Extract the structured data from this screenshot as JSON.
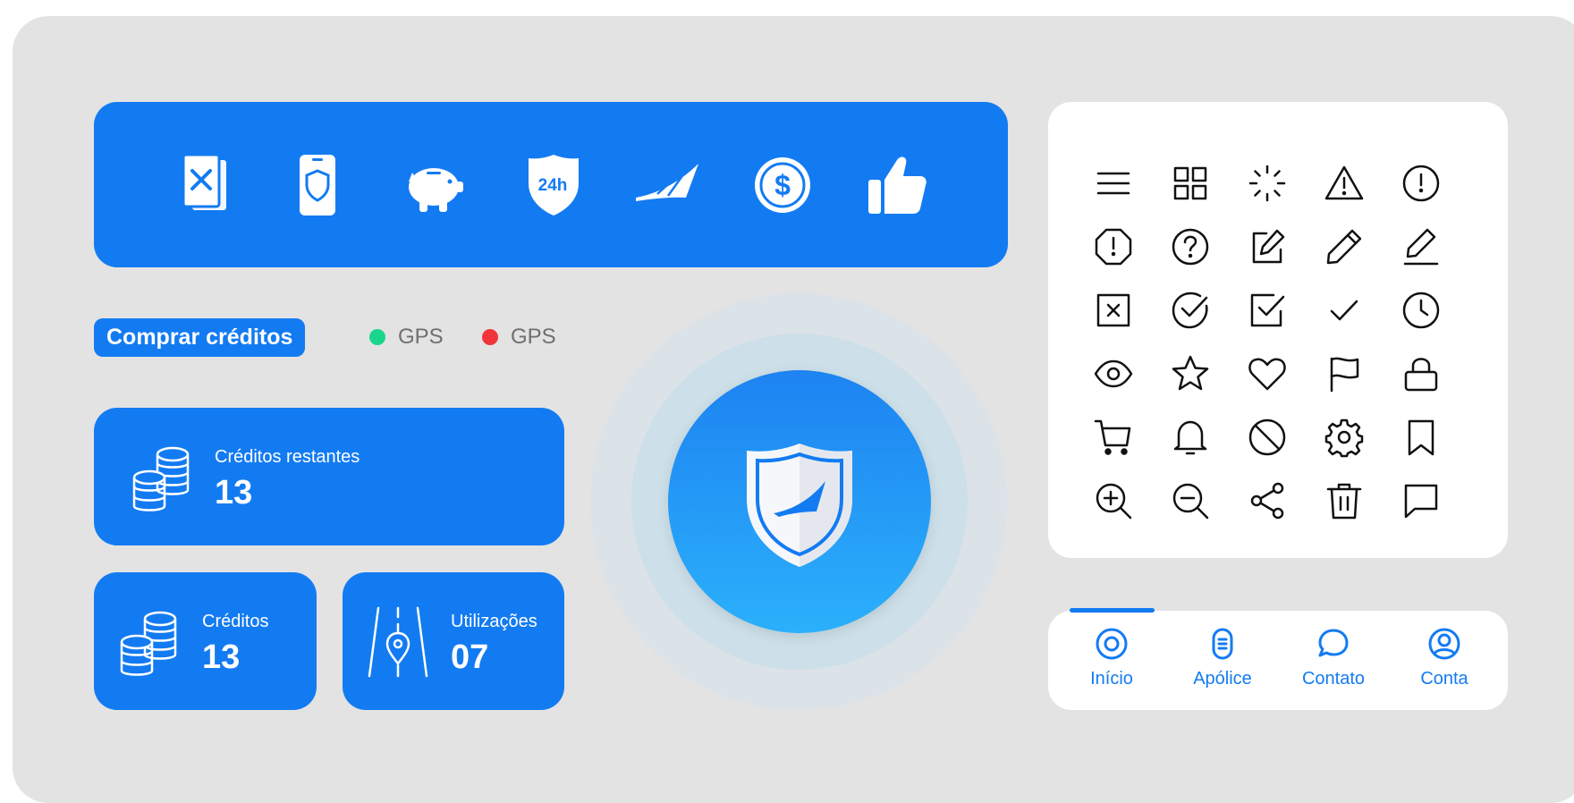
{
  "hero": {
    "icons": [
      "cancel-policy-icon",
      "phone-shield-icon",
      "piggy-bank-icon",
      "shield-24h-icon",
      "brand-wing-icon",
      "dollar-coin-icon",
      "thumbs-up-icon"
    ],
    "badge_text": "24h"
  },
  "buy_button": {
    "label": "Comprar créditos"
  },
  "gps": [
    {
      "label": "GPS",
      "color": "#19d68c"
    },
    {
      "label": "GPS",
      "color": "#f0353b"
    }
  ],
  "cards": {
    "remaining": {
      "label": "Créditos restantes",
      "value": "13",
      "icon": "coins-icon"
    },
    "credits": {
      "label": "Créditos",
      "value": "13",
      "icon": "coins-icon"
    },
    "uses": {
      "label": "Utilizações",
      "value": "07",
      "icon": "road-pin-icon"
    }
  },
  "center": {
    "icon": "shield-logo-icon"
  },
  "icon_grid": [
    "menu-icon",
    "grid-icon",
    "loading-icon",
    "warning-icon",
    "alert-circle-icon",
    "alert-octagon-icon",
    "help-icon",
    "edit-box-icon",
    "pencil-icon",
    "edit-line-icon",
    "close-square-icon",
    "check-circle-icon",
    "check-square-icon",
    "check-icon",
    "clock-icon",
    "eye-icon",
    "star-icon",
    "heart-icon",
    "flag-icon",
    "lock-icon",
    "cart-icon",
    "bell-icon",
    "block-icon",
    "settings-icon",
    "bookmark-icon",
    "zoom-in-icon",
    "zoom-out-icon",
    "share-icon",
    "trash-icon",
    "chat-icon"
  ],
  "tabs": [
    {
      "label": "Início",
      "icon": "home-target-icon"
    },
    {
      "label": "Apólice",
      "icon": "policy-icon"
    },
    {
      "label": "Contato",
      "icon": "chat-bubble-icon"
    },
    {
      "label": "Conta",
      "icon": "account-icon"
    }
  ],
  "colors": {
    "brand": "#137bf2",
    "background": "#e3e3e3",
    "gps_on": "#19d68c",
    "gps_off": "#f0353b"
  }
}
